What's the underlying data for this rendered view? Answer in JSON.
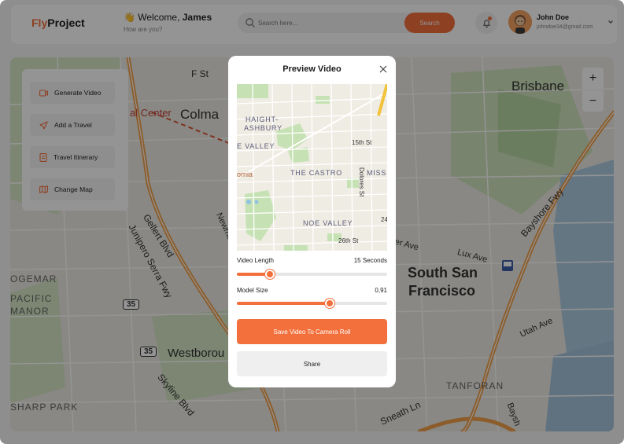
{
  "header": {
    "logo_part1": "Fly",
    "logo_part2": "Project",
    "welcome_prefix": "👋 Welcome, ",
    "welcome_name": "James",
    "welcome_sub": "How are you?",
    "search_placeholder": "Search here...",
    "search_button": "Search",
    "user_name": "John Doe",
    "user_email": "johndoe34@gmail.com"
  },
  "sidebar": {
    "items": [
      {
        "label": "Generate Video",
        "icon": "video-icon"
      },
      {
        "label": "Add a Travel",
        "icon": "send-icon"
      },
      {
        "label": "Travel Itinerary",
        "icon": "document-icon"
      },
      {
        "label": "Change Map",
        "icon": "map-icon"
      }
    ]
  },
  "zoom": {
    "plus": "+",
    "minus": "−"
  },
  "map_labels": {
    "f_st": "F St",
    "colma": "Colma",
    "al_center": "al Center",
    "brisbane": "Brisbane",
    "junipero": "Junipero Serra Fwy",
    "gellert": "Gellert Blvd",
    "newman": "Newma",
    "bayshore": "Bayshore Fwy",
    "ogemar": "OGEMAR",
    "pacific_manor_1": "PACIFIC",
    "pacific_manor_2": "MANOR",
    "rt35a": "35",
    "rt35b": "35",
    "westborough": "Westborou",
    "skyline": "Skyline Blvd",
    "sharp_park": "SHARP PARK",
    "south_sf_1": "South San",
    "south_sf_2": "Francisco",
    "lux_ave": "Lux Ave",
    "utah_ave": "Utah Ave",
    "tanforan": "TANFORAN",
    "sneath": "Sneath Ln",
    "ler_ave": "ler Ave",
    "baysh": "Baysh"
  },
  "modal": {
    "title": "Preview Video",
    "preview_labels": {
      "haight_1": "HAIGHT-",
      "haight_2": "ASHBURY",
      "e_valley": "E VALLEY",
      "fifteenth": "15th St",
      "castro": "THE CASTRO",
      "missi": "MISSI",
      "ornia": "ornia",
      "dolores": "Dolores St",
      "noe": "NOE VALLEY",
      "twentysixth": "26th St",
      "twentyfour": "24"
    },
    "video_length_label": "Video Length",
    "video_length_value": "15 Seconds",
    "video_length_progress": 0.22,
    "model_size_label": "Model Size",
    "model_size_value": "0,91",
    "model_size_progress": 0.62,
    "save_button": "Save Video To Camera Roll",
    "share_button": "Share"
  },
  "colors": {
    "accent": "#f36f3b",
    "road": "#f0a24a",
    "park": "#cfe5bf"
  }
}
